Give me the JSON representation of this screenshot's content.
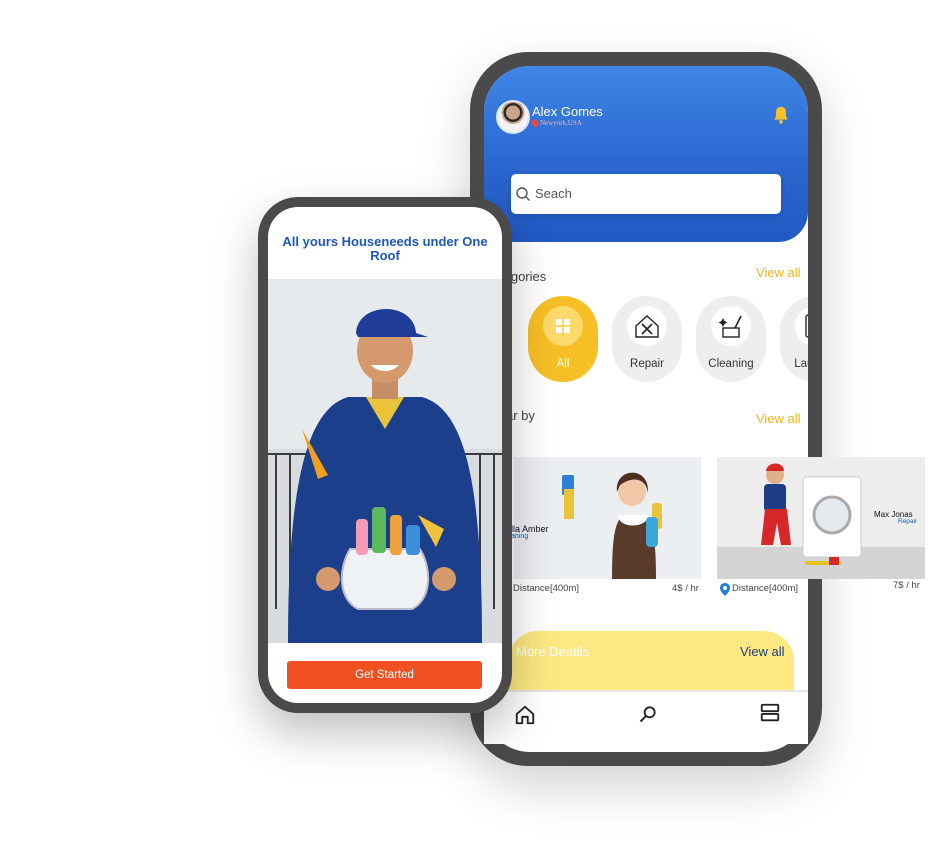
{
  "home": {
    "user": {
      "name": "Alex Gomes",
      "location": "Newyork,USA"
    },
    "search": {
      "placeholder": "Seach"
    },
    "categories": {
      "title": "Categories",
      "visible_title": "tegories",
      "view_all": "View all",
      "items": [
        {
          "label": "All",
          "icon": "grid-icon",
          "active": true
        },
        {
          "label": "Repair",
          "icon": "house-tools-icon",
          "active": false
        },
        {
          "label": "Cleaning",
          "icon": "cleaning-icon",
          "active": false
        },
        {
          "label": "Laundry",
          "icon": "washing-machine-icon",
          "active": false
        }
      ]
    },
    "nearby": {
      "visible_title": "ar by",
      "view_all": "View all",
      "cards": [
        {
          "name": "lla Amber",
          "role": "aning",
          "distance": "Distance[400m]",
          "price": "4$ / hr"
        },
        {
          "name": "Max Jonas",
          "role": "Repair",
          "distance": "Distance[400m]",
          "price": "7$ / hr"
        }
      ]
    },
    "more": {
      "title": "More Deatils",
      "view_all": "View all"
    },
    "nav": [
      "home-icon",
      "search-icon",
      "list-icon"
    ]
  },
  "splash": {
    "title": "All yours Houseneeds under One Roof",
    "cta": "Get Started"
  },
  "colors": {
    "brand_blue": "#2b67cf",
    "accent_yellow": "#f7bf26",
    "cta_orange": "#f05022",
    "frame": "#4a4a4a"
  }
}
